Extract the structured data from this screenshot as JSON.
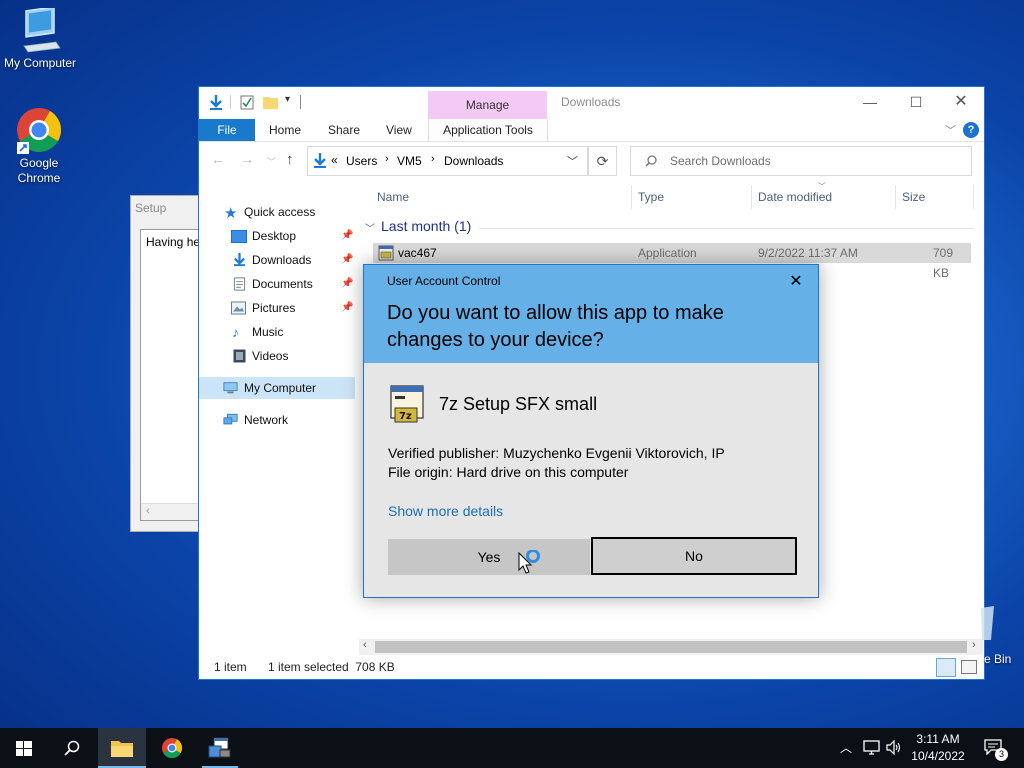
{
  "desktop": {
    "icons": [
      {
        "label": "My Computer",
        "icon": "computer-icon"
      },
      {
        "label": "Google Chrome",
        "icon": "chrome-icon"
      }
    ],
    "recycle_bin_visible_label": "e Bin"
  },
  "setup_window": {
    "title": "Setup",
    "text": "Having help"
  },
  "explorer": {
    "title": "Downloads",
    "context_tab": "Manage",
    "ribbon_tabs": [
      "File",
      "Home",
      "Share",
      "View",
      "Application Tools"
    ],
    "address": {
      "chevron": "«",
      "crumbs": [
        "Users",
        "VM5",
        "Downloads"
      ]
    },
    "search_placeholder": "Search Downloads",
    "nav": {
      "quick_access": "Quick access",
      "items": [
        "Desktop",
        "Downloads",
        "Documents",
        "Pictures",
        "Music",
        "Videos"
      ],
      "my_computer": "My Computer",
      "network": "Network"
    },
    "columns": [
      "Name",
      "Type",
      "Date modified",
      "Size"
    ],
    "group_header": "Last month (1)",
    "file": {
      "name": "vac467",
      "type": "Application",
      "date": "9/2/2022 11:37 AM",
      "size": "709 KB"
    },
    "status": {
      "count": "1 item",
      "selected": "1 item selected  708 KB"
    }
  },
  "uac": {
    "caption": "User Account Control",
    "question": "Do you want to allow this app to make changes to your device?",
    "app_name": "7z Setup SFX small",
    "publisher": "Verified publisher: Muzychenko Evgenii Viktorovich, IP",
    "origin": "File origin: Hard drive on this computer",
    "details_link": "Show more details",
    "yes": "Yes",
    "no": "No"
  },
  "taskbar": {
    "time": "3:11 AM",
    "date": "10/4/2022",
    "notification_count": "3"
  },
  "colors": {
    "uac_header": "#65b0e6",
    "accent": "#1979ca",
    "manage_tab": "#f3c9f5"
  }
}
